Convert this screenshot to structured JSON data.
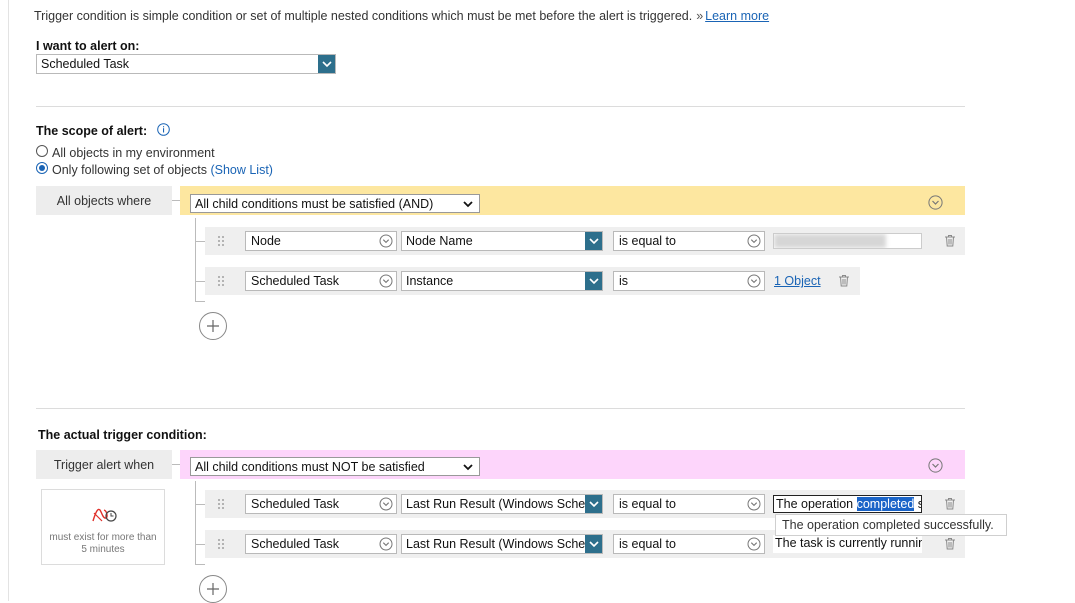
{
  "intro": {
    "text": "Trigger condition is simple condition or set of multiple nested conditions which must be met before the alert is triggered.",
    "raquo": "»",
    "learn_more": "Learn more"
  },
  "alert_on": {
    "label": "I want to alert on:",
    "value": "Scheduled Task"
  },
  "scope": {
    "label": "The scope of alert:",
    "option_all": "All objects in my environment",
    "option_only": "Only following set of objects",
    "show_list": "(Show List)",
    "selected": "only",
    "group_tag": "All objects where",
    "group_operator": "All child conditions must be satisfied (AND)",
    "group_color": "#fde7a0",
    "conditions": [
      {
        "entity": "Node",
        "field": "Node Name",
        "operator": "is equal to",
        "value": ""
      },
      {
        "entity": "Scheduled Task",
        "field": "Instance",
        "operator": "is",
        "value": "1 Object"
      }
    ]
  },
  "trigger": {
    "label": "The actual trigger condition:",
    "group_tag": "Trigger alert when",
    "group_operator": "All child conditions must NOT be satisfied",
    "group_color": "#fdd5fb",
    "time_label": "must exist for more than 5 minutes",
    "conditions": [
      {
        "entity": "Scheduled Task",
        "field": "Last Run Result (Windows Schec",
        "operator": "is equal to",
        "value_pre": "The operation ",
        "value_sel": "completed",
        "value_post": " su"
      },
      {
        "entity": "Scheduled Task",
        "field": "Last Run Result (Windows Schec",
        "operator": "is equal to",
        "value": "The task is currently running"
      }
    ],
    "tooltip": "The operation completed successfully."
  },
  "colors": {
    "accent": "#1a64b5",
    "arrow_bg": "#2d6f8c"
  }
}
